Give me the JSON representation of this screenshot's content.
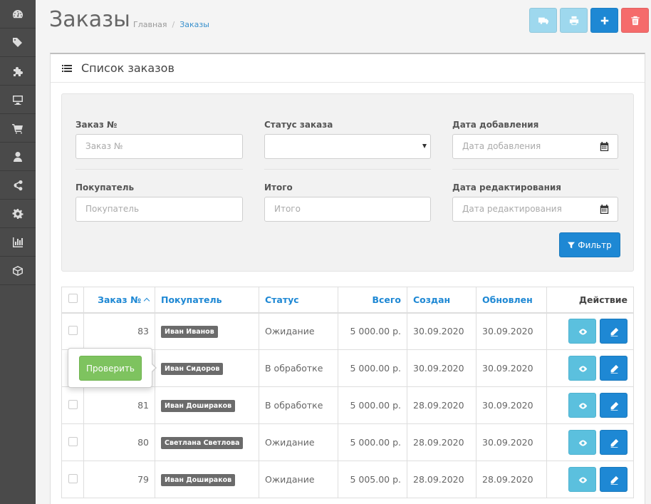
{
  "header": {
    "title": "Заказы",
    "breadcrumb": {
      "home": "Главная",
      "separator": "/",
      "current": "Заказы"
    }
  },
  "sidebar": {
    "items": [
      {
        "icon": "dashboard-icon"
      },
      {
        "icon": "tags-icon"
      },
      {
        "icon": "puzzle-icon"
      },
      {
        "icon": "desktop-icon"
      },
      {
        "icon": "cart-icon"
      },
      {
        "icon": "user-icon"
      },
      {
        "icon": "share-icon"
      },
      {
        "icon": "gear-icon"
      },
      {
        "icon": "bar-chart-icon"
      },
      {
        "icon": "cube-icon"
      }
    ]
  },
  "toolbar": {
    "buttons": [
      "truck-icon",
      "print-icon",
      "plus-icon",
      "trash-icon"
    ],
    "colors": {
      "ship": "#9ed8ee",
      "print": "#9ed8ee",
      "add": "#1e88d4",
      "delete": "#f56b6b"
    }
  },
  "panel": {
    "title": "Список заказов"
  },
  "filter": {
    "order_id": {
      "label": "Заказ №",
      "placeholder": "Заказ №"
    },
    "status": {
      "label": "Статус заказа",
      "value": ""
    },
    "date_added": {
      "label": "Дата добавления",
      "placeholder": "Дата добавления"
    },
    "customer": {
      "label": "Покупатель",
      "placeholder": "Покупатель"
    },
    "total": {
      "label": "Итого",
      "placeholder": "Итого"
    },
    "date_modified": {
      "label": "Дата редактирования",
      "placeholder": "Дата редактирования"
    },
    "button_label": "Фильтр"
  },
  "table": {
    "columns": {
      "order_id": "Заказ №",
      "customer": "Покупатель",
      "status": "Статус",
      "total": "Всего",
      "created": "Создан",
      "updated": "Обновлен",
      "action": "Действие"
    },
    "rows": [
      {
        "id": "83",
        "customer": "Иван Иванов",
        "status": "Ожидание",
        "total": "5 000.00 р.",
        "created": "30.09.2020",
        "updated": "30.09.2020"
      },
      {
        "id": "",
        "customer": "Иван Сидоров",
        "status": "В обработке",
        "total": "5 000.00 р.",
        "created": "30.09.2020",
        "updated": "30.09.2020"
      },
      {
        "id": "81",
        "customer": "Иван Дошираков",
        "status": "В обработке",
        "total": "5 000.00 р.",
        "created": "28.09.2020",
        "updated": "30.09.2020"
      },
      {
        "id": "80",
        "customer": "Светлана Светлова",
        "status": "Ожидание",
        "total": "5 000.00 р.",
        "created": "28.09.2020",
        "updated": "30.09.2020"
      },
      {
        "id": "79",
        "customer": "Иван Дошираков",
        "status": "Ожидание",
        "total": "5 005.00 р.",
        "created": "28.09.2020",
        "updated": "28.09.2020"
      }
    ]
  },
  "popover": {
    "button_label": "Проверить"
  }
}
